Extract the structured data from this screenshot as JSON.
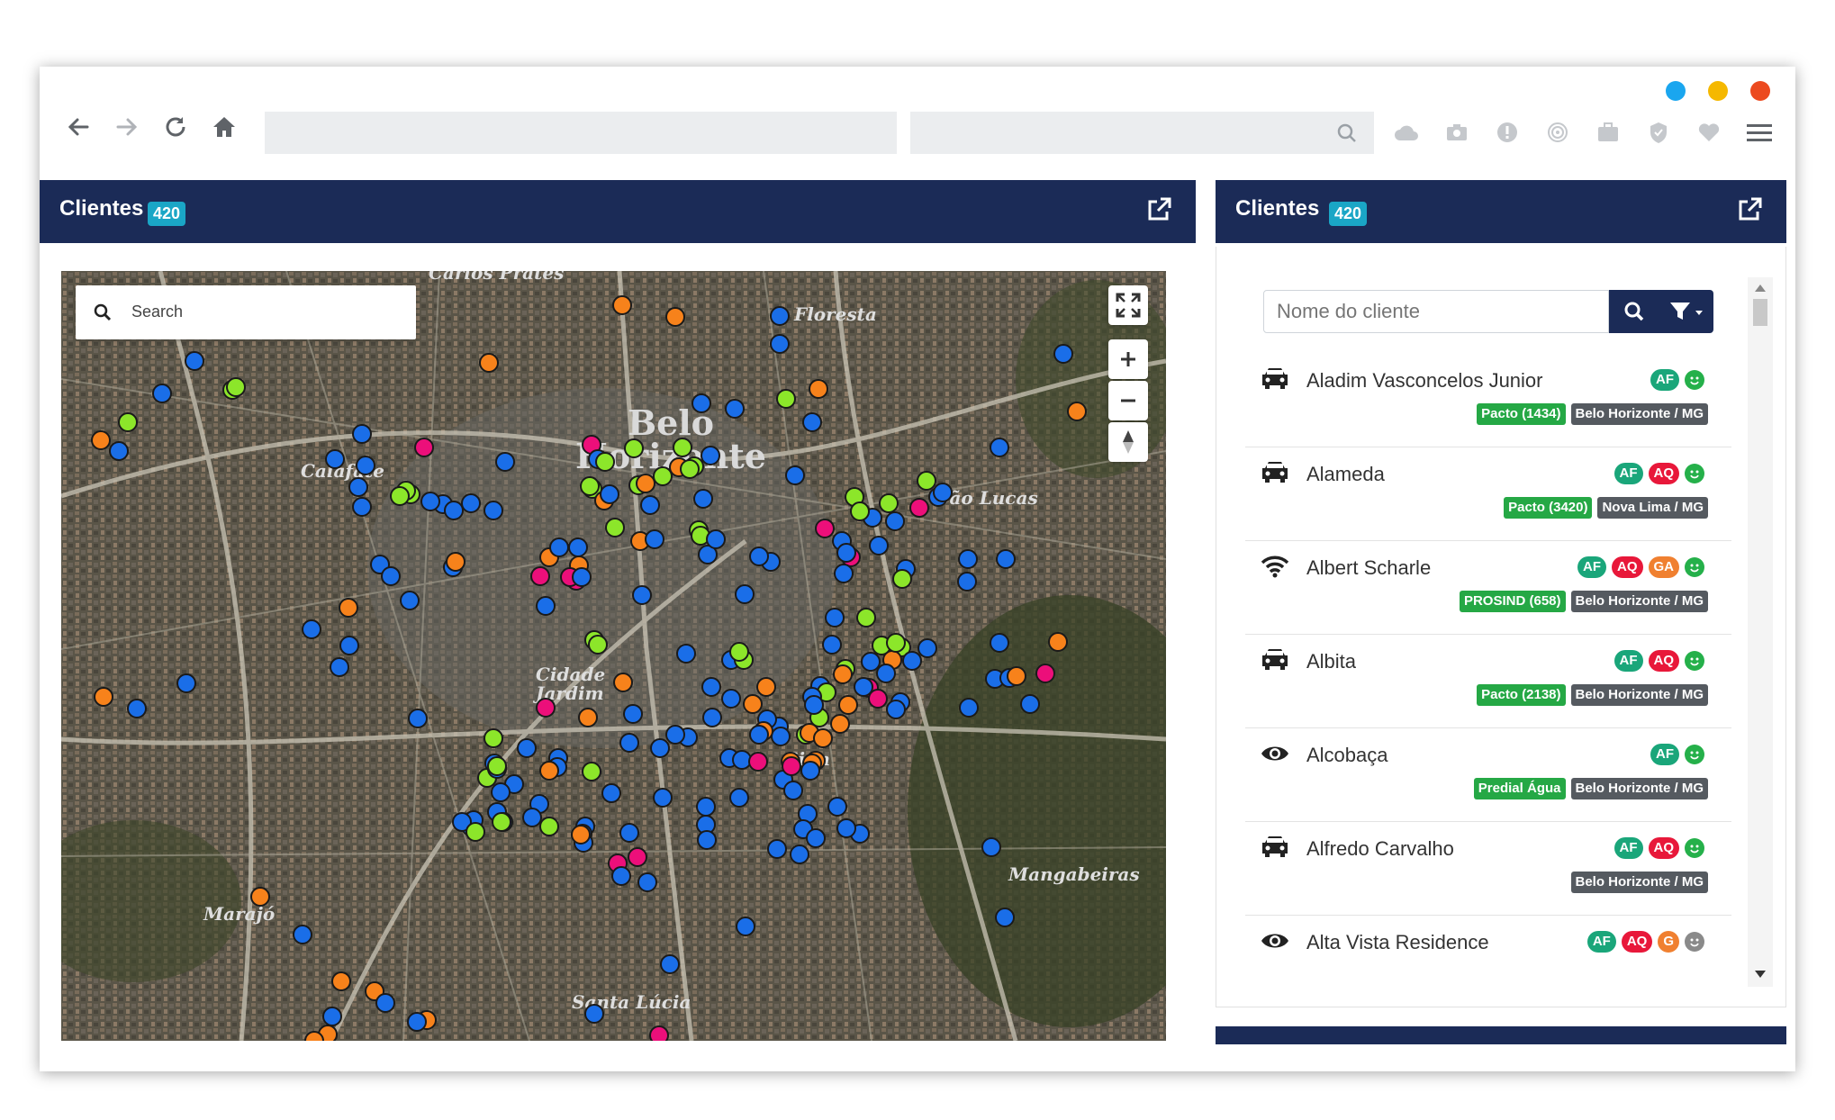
{
  "window": {
    "dots": [
      "#1aa6ef",
      "#f5b800",
      "#ec4a1f"
    ]
  },
  "toolbar": {
    "nav_icons": [
      "back-arrow-icon",
      "forward-arrow-icon",
      "reload-icon",
      "home-icon"
    ],
    "tool_icons": [
      "cloud-upload-icon",
      "camera-icon",
      "alert-icon",
      "fingerprint-icon",
      "briefcase-icon",
      "shield-icon",
      "heart-icon",
      "menu-icon"
    ]
  },
  "map_panel": {
    "title": "Clientes",
    "count": "420"
  },
  "map": {
    "search_placeholder": "Search",
    "place_labels": [
      "Carlos Prates",
      "Floresta",
      "Belo Horizonte",
      "Calafate",
      "São Lucas",
      "Cidade Jardim",
      "Sion",
      "Mangabeiras",
      "Marajó",
      "Santa Lúcia"
    ],
    "marker_colors": {
      "blue": "#1a6ee8",
      "green": "#8ce62a",
      "orange": "#f7821b",
      "pink": "#ec0f7a"
    }
  },
  "list_panel": {
    "title": "Clientes",
    "count": "420",
    "filter_placeholder": "Nome do cliente",
    "rows": [
      {
        "name": "Aladim Vasconcelos Junior",
        "icon": "car-icon",
        "tags": [
          "AF"
        ],
        "smile": "green",
        "labels": [
          {
            "text": "Pacto (1434)",
            "kind": "g"
          },
          {
            "text": "Belo Horizonte / MG",
            "kind": "d"
          }
        ]
      },
      {
        "name": "Alameda",
        "icon": "car-icon",
        "tags": [
          "AF",
          "AQ"
        ],
        "smile": "green",
        "labels": [
          {
            "text": "Pacto (3420)",
            "kind": "g"
          },
          {
            "text": "Nova Lima / MG",
            "kind": "d"
          }
        ]
      },
      {
        "name": "Albert Scharle",
        "icon": "wifi-icon",
        "tags": [
          "AF",
          "AQ",
          "GA"
        ],
        "smile": "green",
        "labels": [
          {
            "text": "PROSIND (658)",
            "kind": "g"
          },
          {
            "text": "Belo Horizonte / MG",
            "kind": "d"
          }
        ]
      },
      {
        "name": "Albita",
        "icon": "car-icon",
        "tags": [
          "AF",
          "AQ"
        ],
        "smile": "green",
        "labels": [
          {
            "text": "Pacto (2138)",
            "kind": "g"
          },
          {
            "text": "Belo Horizonte / MG",
            "kind": "d"
          }
        ]
      },
      {
        "name": "Alcobaça",
        "icon": "eye-icon",
        "tags": [
          "AF"
        ],
        "smile": "green",
        "labels": [
          {
            "text": "Predial Água",
            "kind": "g"
          },
          {
            "text": "Belo Horizonte / MG",
            "kind": "d"
          }
        ]
      },
      {
        "name": "Alfredo Carvalho",
        "icon": "car-icon",
        "tags": [
          "AF",
          "AQ"
        ],
        "smile": "green",
        "labels": [
          {
            "text": "Belo Horizonte / MG",
            "kind": "d"
          }
        ]
      },
      {
        "name": "Alta Vista Residence",
        "icon": "eye-icon",
        "tags": [
          "AF",
          "AQ",
          "G"
        ],
        "smile": "gray",
        "labels": []
      }
    ]
  }
}
